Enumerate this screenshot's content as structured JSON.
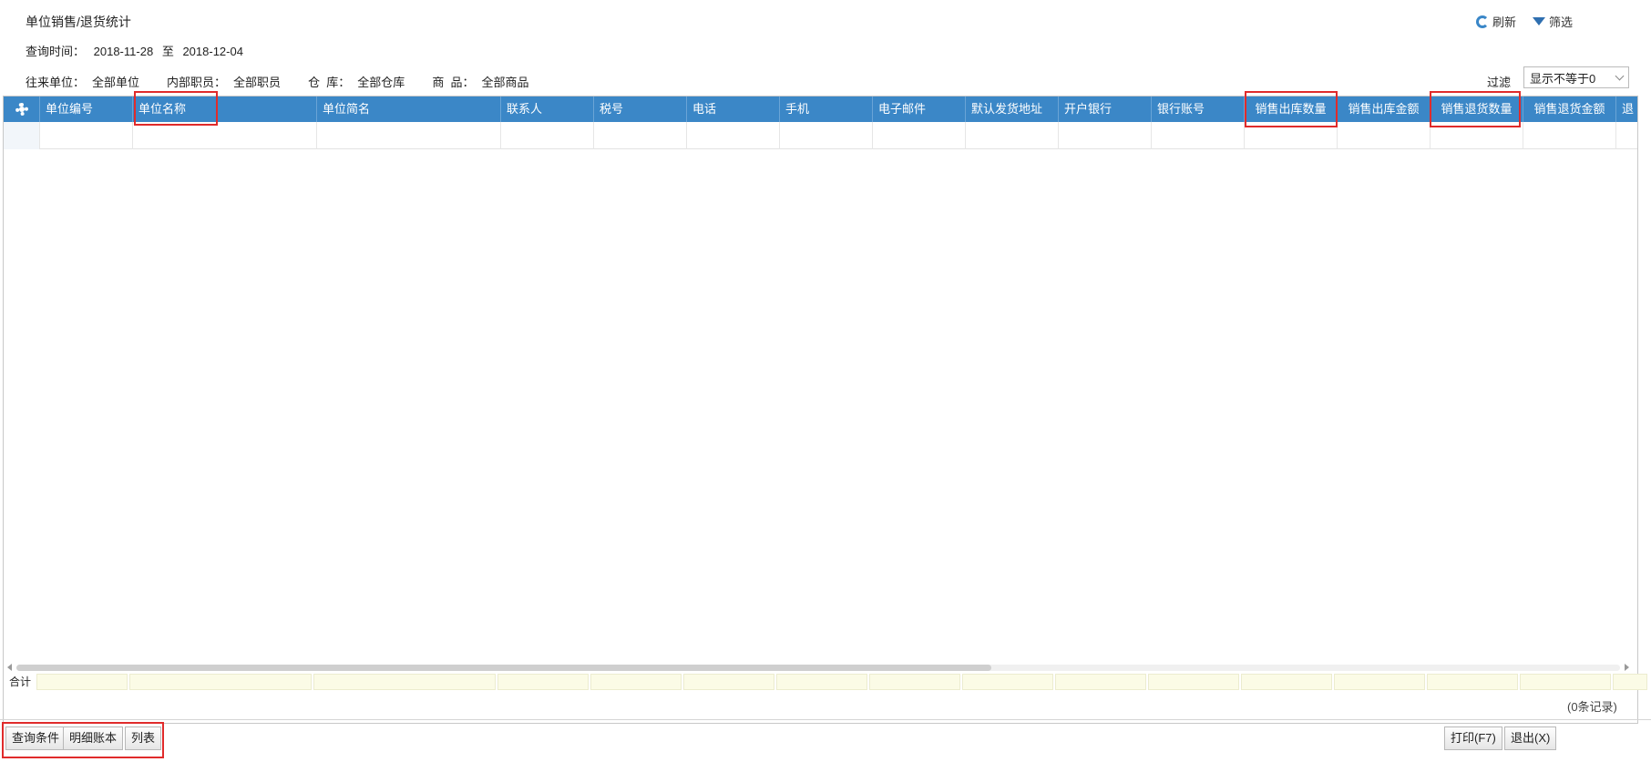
{
  "page": {
    "title": "单位销售/退货统计",
    "query_time_label": "查询时间：",
    "date_from": "2018-11-28",
    "date_to_sep": "至",
    "date_to": "2018-12-04"
  },
  "filters": [
    {
      "label": "往来单位：",
      "value": "全部单位"
    },
    {
      "label": "内部职员：",
      "value": "全部职员"
    },
    {
      "label": "仓  库：",
      "value": "全部仓库"
    },
    {
      "label": "商  品：",
      "value": "全部商品"
    }
  ],
  "toolbar": {
    "refresh_label": "刷新",
    "filter_label": "筛选"
  },
  "filter_select": {
    "label": "过滤",
    "value": "显示不等于0"
  },
  "table": {
    "columns": [
      "单位编号",
      "单位名称",
      "单位简名",
      "联系人",
      "税号",
      "电话",
      "手机",
      "电子邮件",
      "默认发货地址",
      "开户银行",
      "银行账号",
      "销售出库数量",
      "销售出库金额",
      "销售退货数量",
      "销售退货金额",
      "退"
    ],
    "sum_label": "合计",
    "records_text": "(0条记录)"
  },
  "buttons": {
    "query": "查询条件",
    "detail": "明细账本",
    "list": "列表",
    "print": "打印(F7)",
    "exit": "退出(X)"
  },
  "colors": {
    "header_bg": "#3b87c7",
    "highlight": "#e02b2b",
    "sum_bg": "#fbfbe6"
  }
}
